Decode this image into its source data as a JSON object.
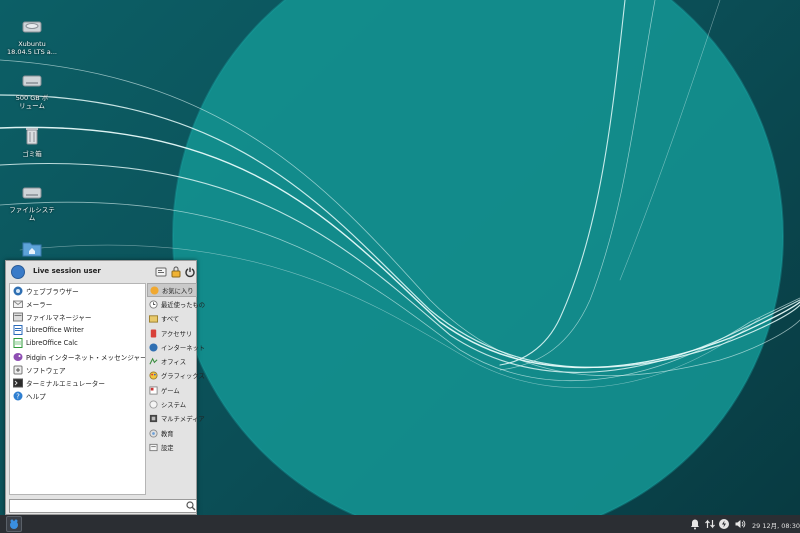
{
  "desktop": {
    "icons": [
      {
        "label": "Xubuntu\n18.04.5 LTS a..."
      },
      {
        "label": "500 GB ボ\nリューム"
      },
      {
        "label": "ゴミ箱"
      },
      {
        "label": "ファイルシステ\nム"
      },
      {
        "label": ""
      }
    ],
    "colors": {
      "background": "#0c5f66",
      "circle": "#13908f"
    }
  },
  "menu": {
    "user": "Live session user",
    "favorites": [
      {
        "label": "ウェブブラウザー",
        "icon": "web-browser-icon"
      },
      {
        "label": "メーラー",
        "icon": "mail-icon"
      },
      {
        "label": "ファイルマネージャー",
        "icon": "file-manager-icon"
      },
      {
        "label": "LibreOffice Writer",
        "icon": "writer-icon"
      },
      {
        "label": "LibreOffice Calc",
        "icon": "calc-icon"
      },
      {
        "label": "Pidgin インターネット・メッセンジャー",
        "icon": "pidgin-icon"
      },
      {
        "label": "ソフトウェア",
        "icon": "software-icon"
      },
      {
        "label": "ターミナルエミュレーター",
        "icon": "terminal-icon"
      },
      {
        "label": "ヘルプ",
        "icon": "help-icon"
      }
    ],
    "categories": [
      {
        "label": "お気に入り",
        "icon": "star-icon",
        "active": true
      },
      {
        "label": "最近使ったもの",
        "icon": "recent-icon"
      },
      {
        "label": "すべて",
        "icon": "all-icon"
      },
      {
        "label": "アクセサリ",
        "icon": "accessories-icon"
      },
      {
        "label": "インターネット",
        "icon": "internet-icon"
      },
      {
        "label": "オフィス",
        "icon": "office-icon"
      },
      {
        "label": "グラフィックス",
        "icon": "graphics-icon"
      },
      {
        "label": "ゲーム",
        "icon": "games-icon"
      },
      {
        "label": "システム",
        "icon": "system-icon"
      },
      {
        "label": "マルチメディア",
        "icon": "multimedia-icon"
      },
      {
        "label": "教育",
        "icon": "education-icon"
      },
      {
        "label": "設定",
        "icon": "settings-icon"
      }
    ],
    "search": {
      "value": "",
      "placeholder": ""
    }
  },
  "panel": {
    "clock": "29 12月, 08:30"
  }
}
